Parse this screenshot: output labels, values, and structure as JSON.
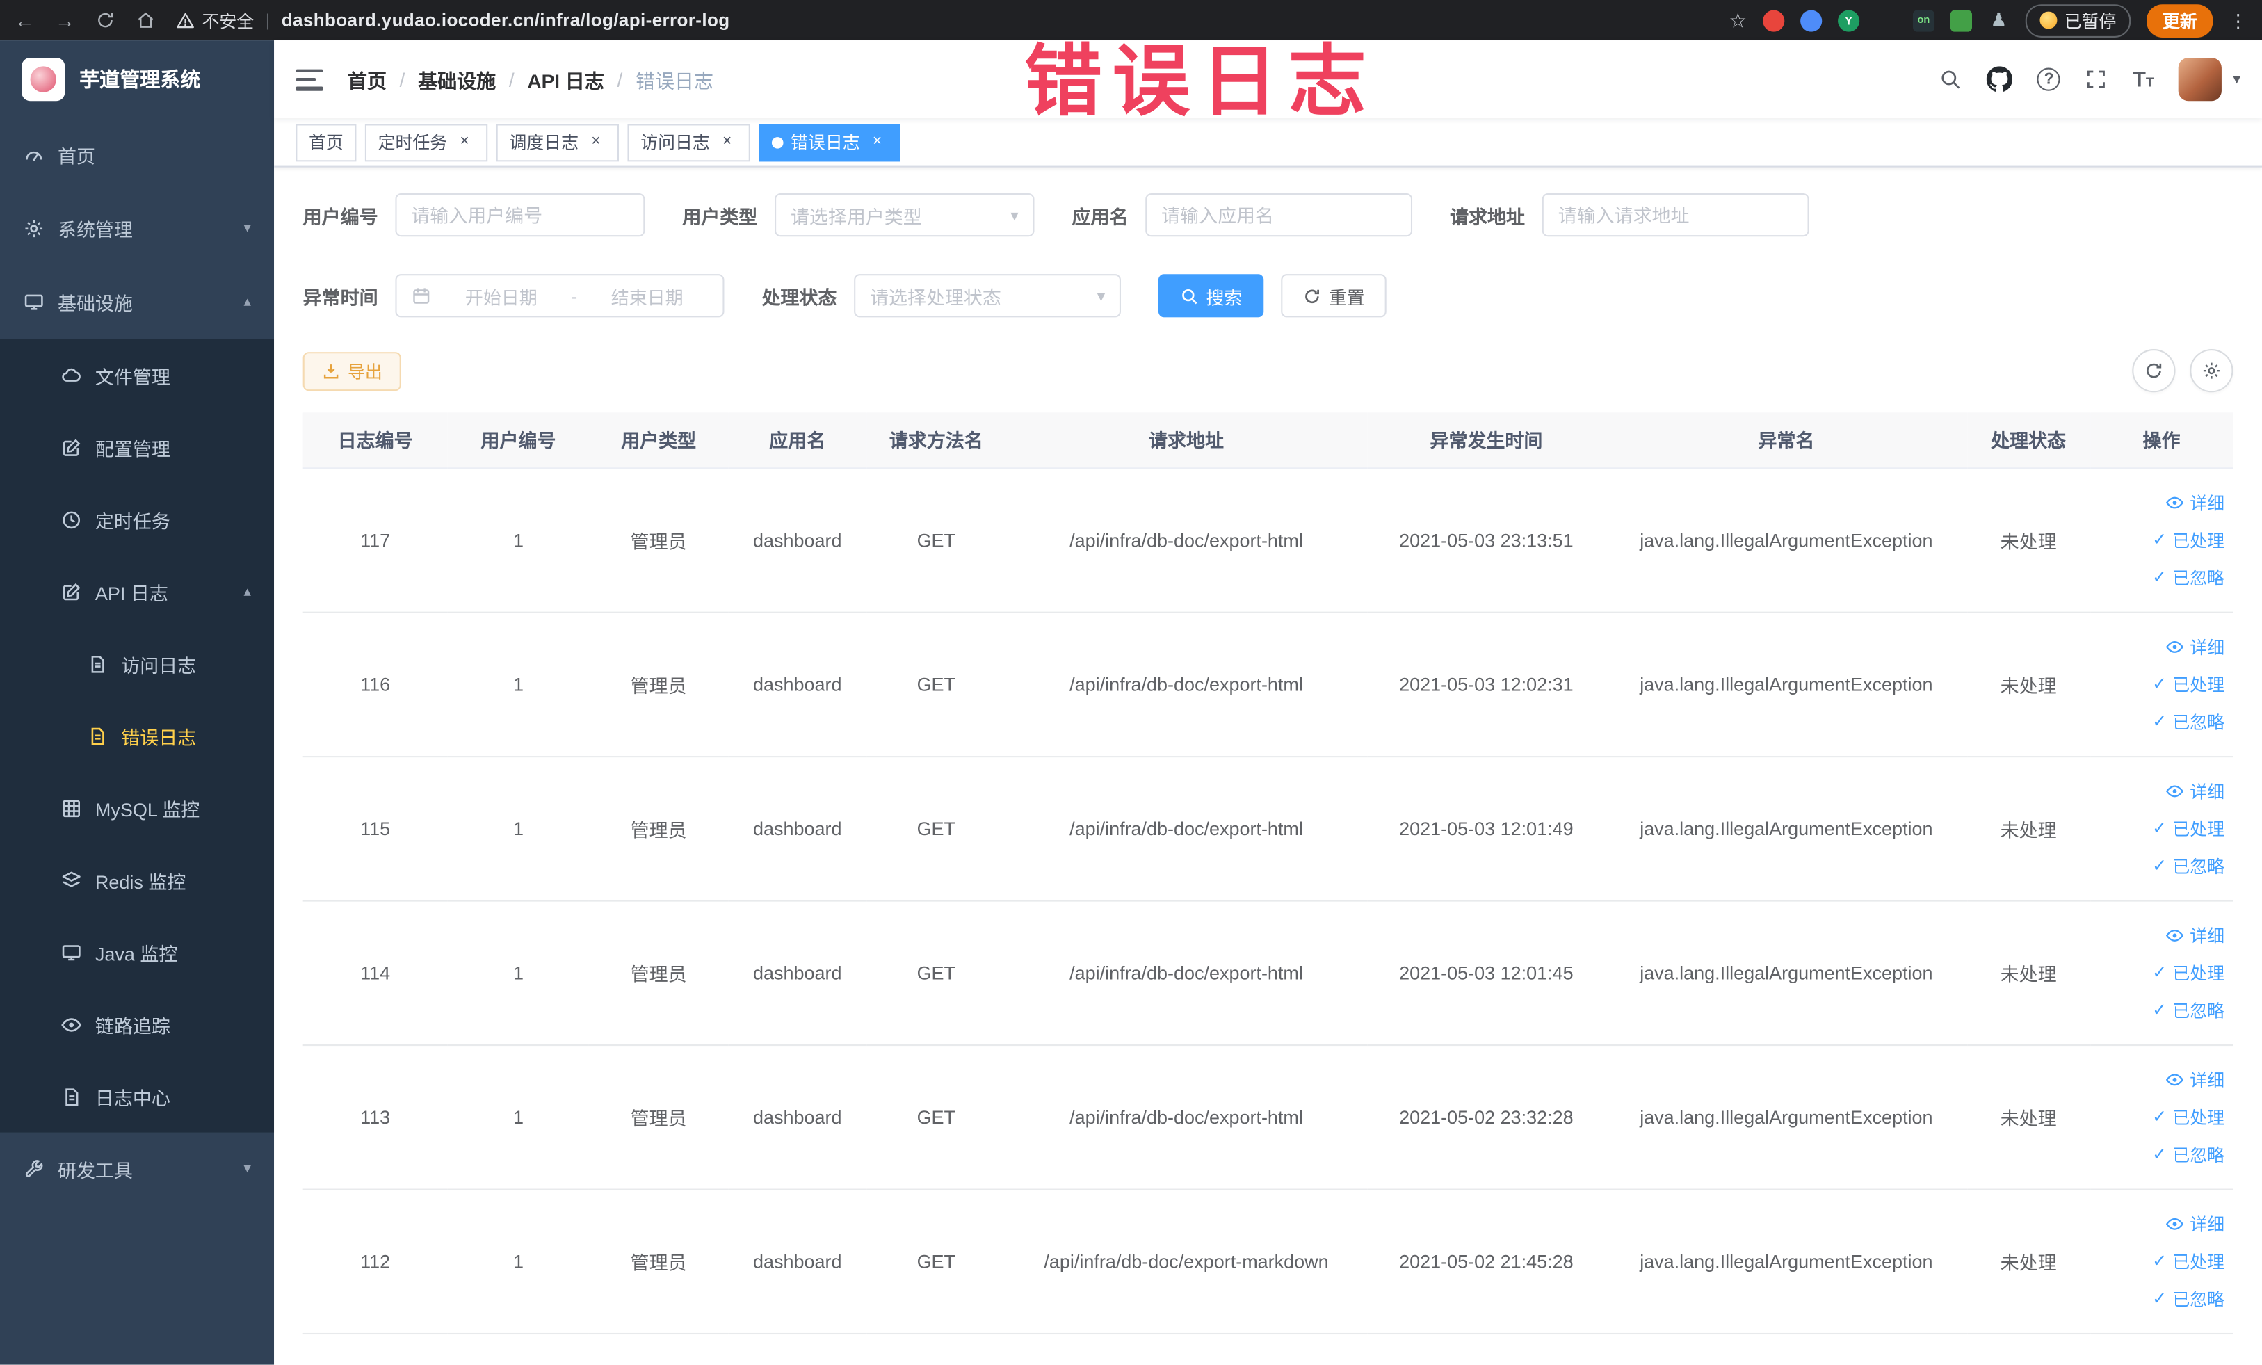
{
  "browser": {
    "security_label": "不安全",
    "url": "dashboard.yudao.iocoder.cn/infra/log/api-error-log",
    "paused_label": "已暂停",
    "update_label": "更新"
  },
  "annotation": {
    "watermark": "错误日志"
  },
  "sidebar": {
    "logo_title": "芋道管理系统",
    "items": [
      {
        "label": "首页"
      },
      {
        "label": "系统管理"
      },
      {
        "label": "基础设施"
      },
      {
        "label": "文件管理"
      },
      {
        "label": "配置管理"
      },
      {
        "label": "定时任务"
      },
      {
        "label": "API 日志"
      },
      {
        "label": "访问日志"
      },
      {
        "label": "错误日志"
      },
      {
        "label": "MySQL 监控"
      },
      {
        "label": "Redis 监控"
      },
      {
        "label": "Java 监控"
      },
      {
        "label": "链路追踪"
      },
      {
        "label": "日志中心"
      },
      {
        "label": "研发工具"
      }
    ]
  },
  "navbar": {
    "breadcrumbs": [
      "首页",
      "基础设施",
      "API 日志",
      "错误日志"
    ]
  },
  "tabs": [
    {
      "label": "首页"
    },
    {
      "label": "定时任务"
    },
    {
      "label": "调度日志"
    },
    {
      "label": "访问日志"
    },
    {
      "label": "错误日志"
    }
  ],
  "filters": {
    "user_id_label": "用户编号",
    "user_id_placeholder": "请输入用户编号",
    "user_type_label": "用户类型",
    "user_type_placeholder": "请选择用户类型",
    "app_name_label": "应用名",
    "app_name_placeholder": "请输入应用名",
    "request_url_label": "请求地址",
    "request_url_placeholder": "请输入请求地址",
    "time_label": "异常时间",
    "time_start_placeholder": "开始日期",
    "time_separator": "-",
    "time_end_placeholder": "结束日期",
    "status_label": "处理状态",
    "status_placeholder": "请选择处理状态",
    "search_label": "搜索",
    "reset_label": "重置"
  },
  "toolbar": {
    "export_label": "导出"
  },
  "table": {
    "headers": [
      "日志编号",
      "用户编号",
      "用户类型",
      "应用名",
      "请求方法名",
      "请求地址",
      "异常发生时间",
      "异常名",
      "处理状态",
      "操作"
    ],
    "action_labels": [
      "详细",
      "已处理",
      "已忽略"
    ],
    "rows": [
      {
        "id": "117",
        "user_id": "1",
        "user_type": "管理员",
        "app": "dashboard",
        "method": "GET",
        "url": "/api/infra/db-doc/export-html",
        "time": "2021-05-03 23:13:51",
        "exception": "java.lang.IllegalArgumentException",
        "status": "未处理"
      },
      {
        "id": "116",
        "user_id": "1",
        "user_type": "管理员",
        "app": "dashboard",
        "method": "GET",
        "url": "/api/infra/db-doc/export-html",
        "time": "2021-05-03 12:02:31",
        "exception": "java.lang.IllegalArgumentException",
        "status": "未处理"
      },
      {
        "id": "115",
        "user_id": "1",
        "user_type": "管理员",
        "app": "dashboard",
        "method": "GET",
        "url": "/api/infra/db-doc/export-html",
        "time": "2021-05-03 12:01:49",
        "exception": "java.lang.IllegalArgumentException",
        "status": "未处理"
      },
      {
        "id": "114",
        "user_id": "1",
        "user_type": "管理员",
        "app": "dashboard",
        "method": "GET",
        "url": "/api/infra/db-doc/export-html",
        "time": "2021-05-03 12:01:45",
        "exception": "java.lang.IllegalArgumentException",
        "status": "未处理"
      },
      {
        "id": "113",
        "user_id": "1",
        "user_type": "管理员",
        "app": "dashboard",
        "method": "GET",
        "url": "/api/infra/db-doc/export-html",
        "time": "2021-05-02 23:32:28",
        "exception": "java.lang.IllegalArgumentException",
        "status": "未处理"
      },
      {
        "id": "112",
        "user_id": "1",
        "user_type": "管理员",
        "app": "dashboard",
        "method": "GET",
        "url": "/api/infra/db-doc/export-markdown",
        "time": "2021-05-02 21:45:28",
        "exception": "java.lang.IllegalArgumentException",
        "status": "未处理"
      }
    ]
  },
  "icons": {
    "back": "←",
    "forward": "→",
    "star": "☆",
    "menu_dots": "⋮",
    "chevron_down": "▾",
    "chevron_up": "▴",
    "caret_down": "▾",
    "close": "×",
    "check": "✓",
    "question_mark": "?",
    "select_arrow": "▾",
    "breadcrumb_sep": "/",
    "ext_y": "Y",
    "ext_on": "on",
    "ext_pawn": "♟",
    "font_large": "T",
    "font_small": "T"
  },
  "colors": {
    "primary": "#409eff",
    "sidebar_active": "#ffd04b",
    "warning": "#e6a23c",
    "watermark": "#ee3352",
    "tab_active": "#409eff",
    "sidebar_bg": "#304156",
    "submenu_bg": "#1f2d3d"
  }
}
